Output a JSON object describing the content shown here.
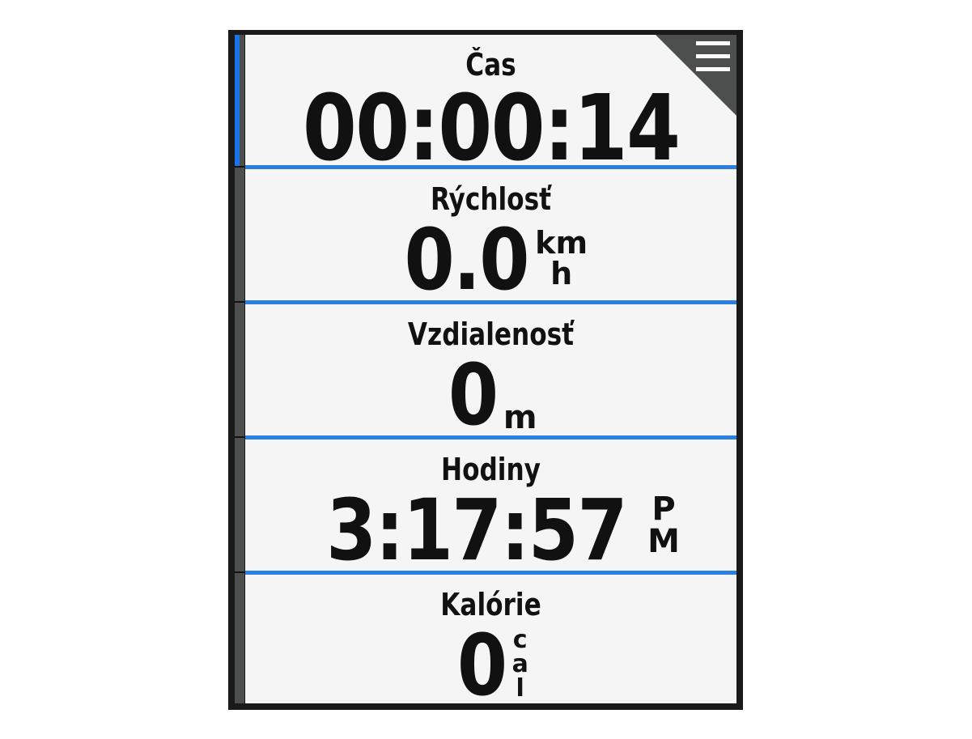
{
  "fields": [
    {
      "label": "Čas",
      "value": "00:00:14",
      "unit": []
    },
    {
      "label": "Rýchlosť",
      "value": "0.0",
      "unit": [
        "km",
        "h"
      ]
    },
    {
      "label": "Vzdialenosť",
      "value": "0",
      "unit": [
        "m"
      ]
    },
    {
      "label": "Hodiny",
      "value": "3:17:57",
      "unit": [
        "P",
        "M"
      ]
    },
    {
      "label": "Kalórie",
      "value": "0",
      "unit": [
        "c",
        "a",
        "l"
      ]
    }
  ],
  "colors": {
    "accent": "#2a7fe0",
    "screen_bg": "#f5f5f5",
    "frame": "#1a1a1a",
    "sidebar": "#4d4f4f",
    "menu_corner": "#4d4f4f"
  },
  "icons": {
    "menu": "hamburger-menu-icon"
  }
}
